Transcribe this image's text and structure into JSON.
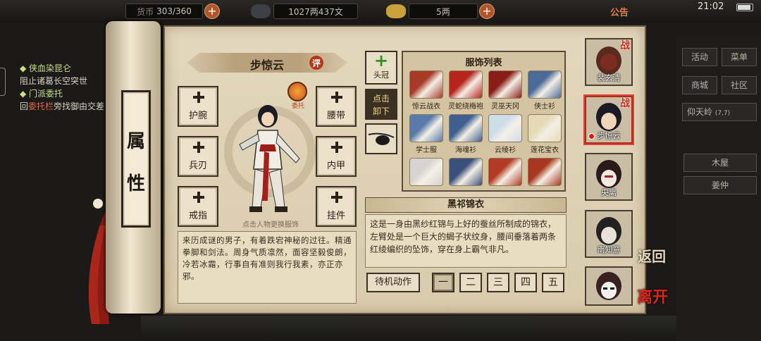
{
  "topbar": {
    "bag_label": "货币",
    "bag_count": "303/360",
    "money": "1027两437文",
    "ingot": "5两",
    "notice": "公告",
    "time": "21:02"
  },
  "left_quests": [
    {
      "title": "侠血染昆仑",
      "text": "阻止诸葛长空突世"
    },
    {
      "title": "门派委托",
      "text_pre": "回",
      "text_hl": "委托栏",
      "text_post": "旁找御由交差"
    }
  ],
  "scroll_tag": "属性",
  "character": {
    "name": "步惊云",
    "eval_label": "评",
    "entrust_label": "委托",
    "hint": "点击人物更换服饰",
    "bio": "来历成谜的男子，有着跌宕神秘的过往。精通拳脚和剑法。周身气质凛然，面容坚毅俊朗，冷若冰霜，行事自有准则我行我素，亦正亦邪。"
  },
  "slots_left": [
    {
      "label": "护腕"
    },
    {
      "label": "兵刃"
    },
    {
      "label": "戒指"
    }
  ],
  "slots_right": [
    {
      "label": "腰带"
    },
    {
      "label": "内甲"
    },
    {
      "label": "挂件"
    }
  ],
  "side_tabs": {
    "head": "头冠",
    "unequip_1": "点击",
    "unequip_2": "卸下"
  },
  "outfit_list": {
    "title": "服饰列表",
    "items": [
      {
        "name": "惊云战衣",
        "color": "#a83a2a"
      },
      {
        "name": "灵蛇绕梅袍",
        "color": "#b5251c"
      },
      {
        "name": "灵巫天冈",
        "color": "#8b1d18"
      },
      {
        "name": "侠士衫",
        "color": "#4c6a96"
      },
      {
        "name": "学士服",
        "color": "#5a78a8"
      },
      {
        "name": "海魂衫",
        "color": "#3e5f8f"
      },
      {
        "name": "云绫衫",
        "color": "#cfdde8"
      },
      {
        "name": "莲花宝衣",
        "color": "#e5d9b6"
      },
      {
        "name": "",
        "color": "#d6d3d0"
      },
      {
        "name": "",
        "color": "#3a4f7a"
      },
      {
        "name": "",
        "color": "#b33a24"
      },
      {
        "name": "",
        "color": "#a8371f"
      }
    ]
  },
  "outfit_desc": {
    "title": "黑祁锦衣",
    "text": "这是一身由黑纱红锦与上好的蚕丝所制成的锦衣，左臂处是一个巨大的蝎子状纹身，腰间垂落着两条红绫编织的坠饰，穿在身上霸气非凡。"
  },
  "idle_label": "待机动作",
  "idle_options": [
    "一",
    "二",
    "三",
    "四",
    "五"
  ],
  "portraits": [
    {
      "name": "裴玄清",
      "war": "战"
    },
    {
      "name": "步惊云",
      "war": "战"
    },
    {
      "name": "央离",
      "war": ""
    },
    {
      "name": "南知意",
      "war": ""
    },
    {
      "name": "",
      "war": ""
    }
  ],
  "right_menu": {
    "activity": "活动",
    "menu": "菜单",
    "shop": "商城",
    "community": "社区",
    "location": "仰天岭",
    "coords": "(7,7)",
    "place1": "木屋",
    "place2": "姜仲"
  },
  "back_label": "返回",
  "leave_label": "离开"
}
